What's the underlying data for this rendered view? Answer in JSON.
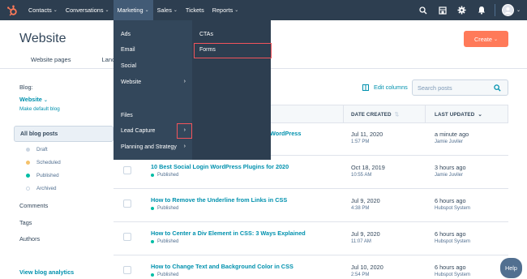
{
  "nav": {
    "items": [
      {
        "label": "Contacts",
        "has_caret": true
      },
      {
        "label": "Conversations",
        "has_caret": true
      },
      {
        "label": "Marketing",
        "has_caret": true
      },
      {
        "label": "Sales",
        "has_caret": true
      },
      {
        "label": "Tickets",
        "has_caret": false
      },
      {
        "label": "Reports",
        "has_caret": true
      }
    ],
    "active": "Marketing",
    "bg_color": "#2d3e50",
    "icons": [
      "search-icon",
      "marketplace-icon",
      "gear-icon",
      "bell-icon"
    ],
    "caret": "⌄"
  },
  "page": {
    "title": "Website",
    "create_label": "Create",
    "tabs": [
      "Website pages",
      "Landing"
    ]
  },
  "sidebar": {
    "blog_label": "Blog:",
    "blog_select": "Website",
    "make_default": "Make default blog",
    "all_posts": "All blog posts",
    "statuses": [
      {
        "label": "Draft",
        "color": "#cbd6e2"
      },
      {
        "label": "Scheduled",
        "color": "#f5c26b"
      },
      {
        "label": "Published",
        "color": "#00bda5"
      },
      {
        "label": "Archived",
        "color": "#ffffff"
      }
    ],
    "links": [
      "Comments",
      "Tags",
      "Authors"
    ],
    "analytics": "View blog analytics"
  },
  "toolbar": {
    "edit_columns": "Edit columns",
    "search_placeholder": "Search posts"
  },
  "table": {
    "headers": [
      "DATE CREATED",
      "LAST UPDATED"
    ],
    "rows": [
      {
        "title": "WordPress",
        "status": "",
        "created": "Jul 11, 2020",
        "created_time": "1:57 PM",
        "updated": "a minute ago",
        "updated_by": "Jamie Juviler"
      },
      {
        "title": "10 Best Social Login WordPress Plugins for 2020",
        "status": "Published",
        "created": "Oct 18, 2019",
        "created_time": "10:55 AM",
        "updated": "3 hours ago",
        "updated_by": "Jamie Juviler"
      },
      {
        "title": "How to Remove the Underline from Links in CSS",
        "status": "Published",
        "created": "Jul 9, 2020",
        "created_time": "4:38 PM",
        "updated": "6 hours ago",
        "updated_by": "Hubspot System"
      },
      {
        "title": "How to Center a Div Element in CSS: 3 Ways Explained",
        "status": "Published",
        "created": "Jul 9, 2020",
        "created_time": "11:07 AM",
        "updated": "6 hours ago",
        "updated_by": "Hubspot System"
      },
      {
        "title": "How to Change Text and Background Color in CSS",
        "status": "Published",
        "created": "Jul 10, 2020",
        "created_time": "2:54 PM",
        "updated": "6 hours ago",
        "updated_by": "Hubspot System"
      }
    ]
  },
  "marketing_menu": {
    "left": [
      {
        "label": "Ads",
        "submenu": false
      },
      {
        "label": "Email",
        "submenu": false
      },
      {
        "label": "Social",
        "submenu": false
      },
      {
        "label": "Website",
        "submenu": true
      },
      {
        "label": "Files",
        "submenu": false
      },
      {
        "label": "Lead Capture",
        "submenu": true
      },
      {
        "label": "Planning and Strategy",
        "submenu": true
      }
    ],
    "right": [
      {
        "label": "CTAs"
      },
      {
        "label": "Forms"
      }
    ],
    "highlight_color": "#f2545b"
  },
  "help": {
    "label": "Help"
  },
  "colors": {
    "accent": "#ff7a59",
    "link": "#0091ae",
    "text": "#33475b"
  }
}
